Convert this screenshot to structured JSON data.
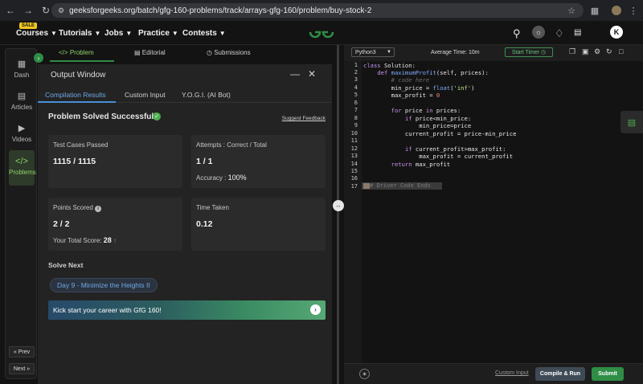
{
  "browser": {
    "url": "geeksforgeeks.org/batch/gfg-160-problems/track/arrays-gfg-160/problem/buy-stock-2"
  },
  "nav": {
    "sale_badge": "SALE",
    "items": [
      "Courses",
      "Tutorials",
      "Jobs",
      "Practice",
      "Contests"
    ],
    "avatar_letter": "K"
  },
  "sidebar": {
    "items": [
      "Dash",
      "Articles",
      "Videos",
      "Problems"
    ],
    "prev": "« Prev",
    "next": "Next »"
  },
  "problem_tabs": [
    "Problem",
    "Editorial",
    "Submissions"
  ],
  "output": {
    "title": "Output Window",
    "tabs": [
      "Compilation Results",
      "Custom Input",
      "Y.O.G.I. (AI Bot)"
    ],
    "status": "Problem Solved Successfully",
    "feedback": "Suggest Feedback",
    "test_cases_label": "Test Cases Passed",
    "test_cases_value": "1115 / 1115",
    "attempts_label": "Attempts : Correct / Total",
    "attempts_value": "1 / 1",
    "accuracy_label": "Accuracy :",
    "accuracy_value": "100%",
    "points_label": "Points Scored",
    "points_value": "2 / 2",
    "total_score_label": "Your Total Score:",
    "total_score_value": "28",
    "time_label": "Time Taken",
    "time_value": "0.12",
    "solve_next": "Solve Next",
    "next_problem": "Day 9 - Minimize the Heights II",
    "banner": "Kick start your career with GfG 160!"
  },
  "editor": {
    "language": "Python3",
    "avg_time": "Average Time: 10m",
    "start_timer": "Start Timer",
    "current_line_text": "Driver Code Ends",
    "custom_input": "Custom Input",
    "compile_run": "Compile & Run",
    "submit": "Submit"
  },
  "colors": {
    "accent_green": "#2f8d46",
    "link_blue": "#6ea8e6"
  }
}
